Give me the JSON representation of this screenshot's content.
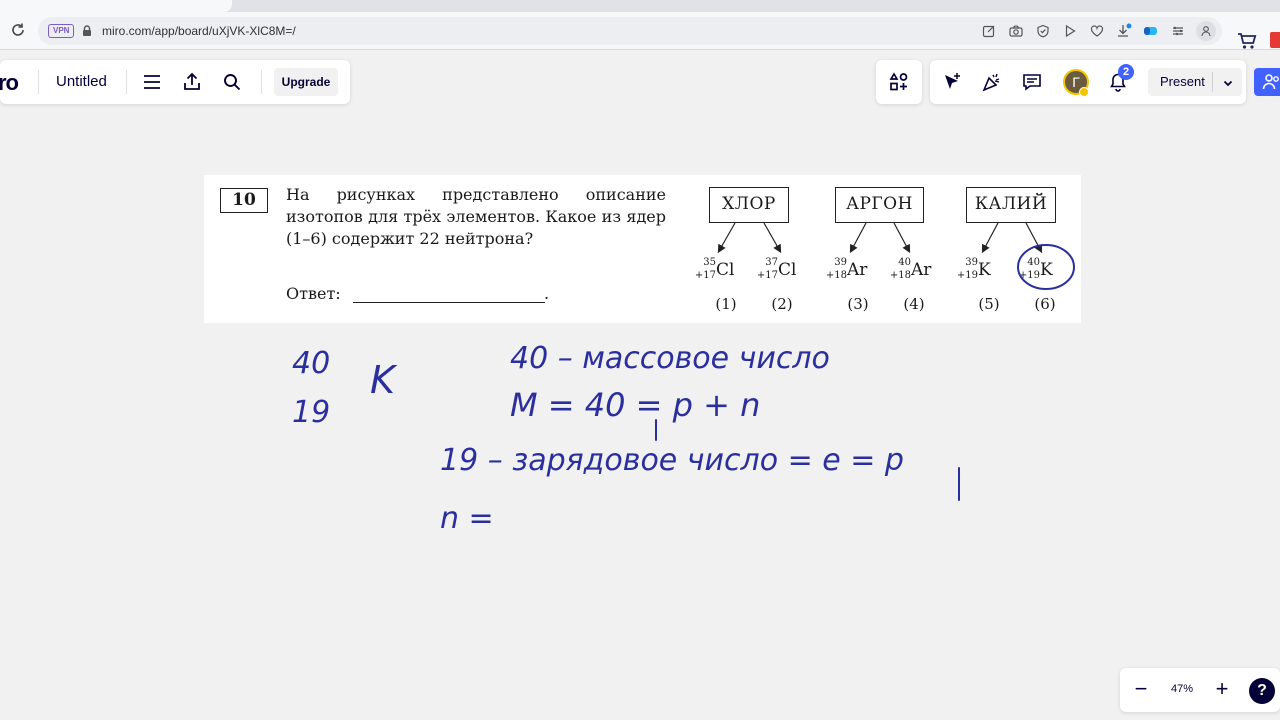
{
  "browser": {
    "vpn_label": "VPN",
    "url": "miro.com/app/board/uXjVK-XlC8M=/"
  },
  "toolbar": {
    "logo_fragment": "ro",
    "board_title": "Untitled",
    "upgrade_label": "Upgrade",
    "avatar_initial": "Г",
    "notifications_count": "2",
    "present_label": "Present"
  },
  "task": {
    "number": "10",
    "question": "На рисунках представлено описание изотопов для трёх элементов. Какое из ядер (1–6) содержит 22 нейтрона?",
    "answer_label": "Ответ:",
    "elements": [
      {
        "name": "ХЛОР"
      },
      {
        "name": "АРГОН"
      },
      {
        "name": "КАЛИЙ"
      }
    ],
    "isotopes": [
      {
        "mass": "35",
        "charge": "+17",
        "symbol": "Cl",
        "index": "(1)"
      },
      {
        "mass": "37",
        "charge": "+17",
        "symbol": "Cl",
        "index": "(2)"
      },
      {
        "mass": "39",
        "charge": "+18",
        "symbol": "Ar",
        "index": "(3)"
      },
      {
        "mass": "40",
        "charge": "+18",
        "symbol": "Ar",
        "index": "(4)"
      },
      {
        "mass": "39",
        "charge": "+19",
        "symbol": "K",
        "index": "(5)"
      },
      {
        "mass": "40",
        "charge": "+19",
        "symbol": "K",
        "index": "(6)"
      }
    ]
  },
  "handwriting": {
    "line1_mass": "40",
    "line1_charge": "19",
    "line1_symbol": "K",
    "note_mass": "40 – массовое число",
    "note_formula": "M = 40 = p + n",
    "note_charge": "19 – зарядовое число = e = p",
    "note_neutrons": "n =",
    "ink_color": "#2b2f9e"
  },
  "zoom": {
    "level": "47%",
    "minus": "−",
    "plus": "+",
    "help": "?"
  }
}
